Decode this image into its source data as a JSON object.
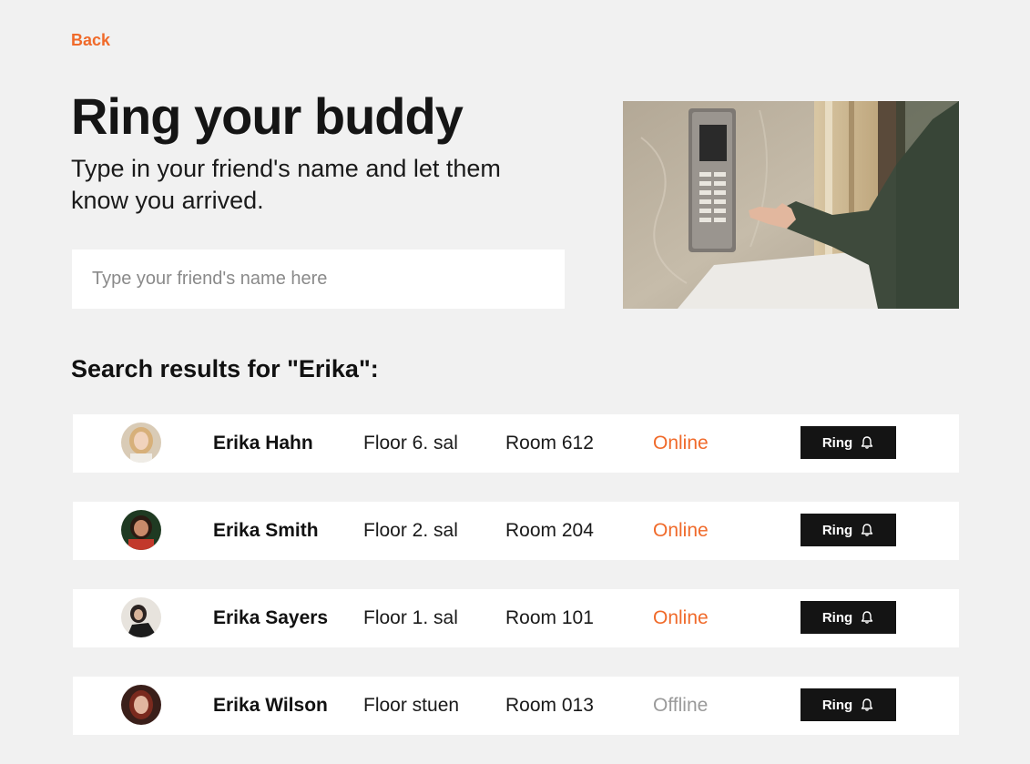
{
  "nav": {
    "back_label": "Back"
  },
  "header": {
    "title": "Ring your buddy",
    "subtitle": "Type in your friend's name and let them know you arrived."
  },
  "search": {
    "placeholder": "Type your friend's name here",
    "value": ""
  },
  "results": {
    "heading": "Search results for \"Erika\":",
    "items": [
      {
        "name": "Erika Hahn",
        "floor": "Floor 6. sal",
        "room": "Room 612",
        "status": "Online",
        "button": "Ring"
      },
      {
        "name": "Erika Smith",
        "floor": "Floor 2. sal",
        "room": "Room 204",
        "status": "Online",
        "button": "Ring"
      },
      {
        "name": "Erika Sayers",
        "floor": "Floor 1. sal",
        "room": "Room 101",
        "status": "Online",
        "button": "Ring"
      },
      {
        "name": "Erika Wilson",
        "floor": "Floor stuen",
        "room": "Room 013",
        "status": "Offline",
        "button": "Ring"
      }
    ]
  },
  "icons": {
    "ring": "bell-icon"
  },
  "colors": {
    "accent": "#f06a2a",
    "button_bg": "#141414",
    "offline": "#9a9a9a",
    "background": "#f1f1f1"
  }
}
